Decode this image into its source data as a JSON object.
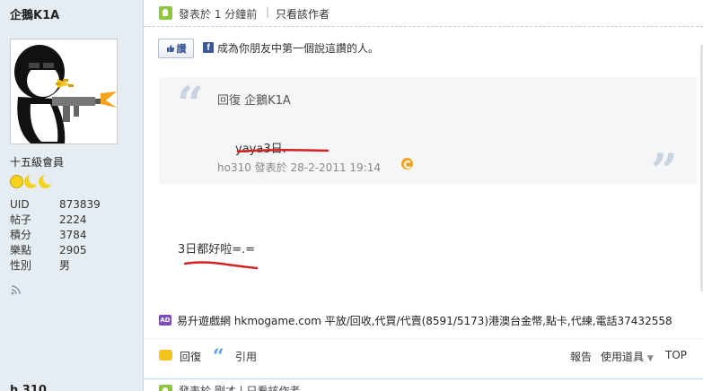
{
  "user": {
    "name": "企鵝K1A",
    "rank": "十五級會員",
    "stats": [
      {
        "label": "UID",
        "value": "873839"
      },
      {
        "label": "帖子",
        "value": "2224"
      },
      {
        "label": "積分",
        "value": "3784"
      },
      {
        "label": "樂點",
        "value": "2905"
      },
      {
        "label": "性別",
        "value": "男"
      }
    ]
  },
  "post": {
    "time": "發表於 1 分鐘前",
    "separator": "|",
    "only_author": "只看該作者",
    "like_label": "讚",
    "like_text": "成為你朋友中第一個說這讚的人。",
    "quote": {
      "reply_to": "回復  企鵝K1A",
      "text": "yaya3日.",
      "meta": "ho310 發表於 28-2-2011 19:14"
    },
    "body": "3日都好啦=.=",
    "ad": "易升遊戲網 hkmogame.com 平放/回收,代買/代賣(8591/5173)港澳台金幣,點卡,代練,電話37432558",
    "actions": {
      "reply": "回復",
      "quote": "引用",
      "report": "報告",
      "tools": "使用道具",
      "top": "TOP"
    }
  },
  "next_post": {
    "user_partial": "h    310",
    "time_partial": "發表於 剛才  |  只看該作者"
  },
  "colors": {
    "sidebar_bg": "#e5edf2",
    "online_green": "#8ec63f",
    "annotation_red": "#d42020"
  }
}
